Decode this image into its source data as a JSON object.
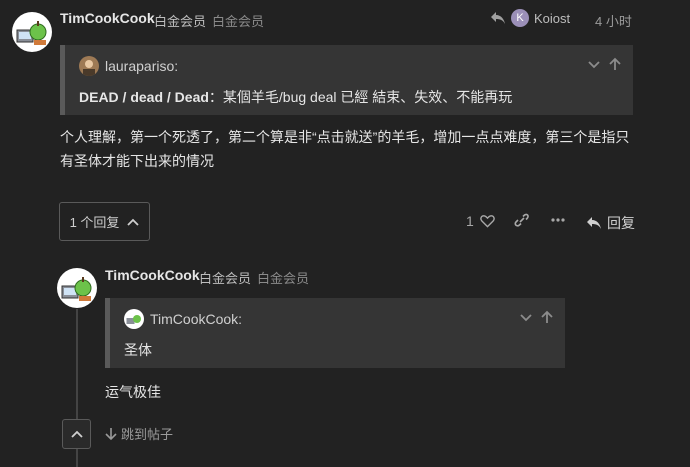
{
  "post1": {
    "username": "TimCookCook",
    "flair1": "白金会员",
    "flair2": "白金会员",
    "reply_to": {
      "avatar_letter": "K",
      "name": "Koiost"
    },
    "time": "4 小时",
    "quote": {
      "author": "laurapariso:",
      "text_bold": "DEAD / dead / Dead",
      "text_rest": "：某個羊毛/bug deal 已經 結束、失效、不能再玩"
    },
    "body": "个人理解，第一个死透了，第二个算是非“点击就送”的羊毛，增加一点点难度，第三个是指只有圣体才能下出来的情况",
    "replies_label": "1 个回复",
    "like_count": "1",
    "reply_label": "回复"
  },
  "post2": {
    "username": "TimCookCook",
    "flair1": "白金会员",
    "flair2": "白金会员",
    "quote": {
      "author": "TimCookCook:",
      "text": "圣体"
    },
    "body": "运气极佳",
    "jump_label": "跳到帖子"
  },
  "colors": {
    "background": "#222222",
    "quote_bg": "#353535",
    "avatar_badge": "#9b8fb8"
  }
}
